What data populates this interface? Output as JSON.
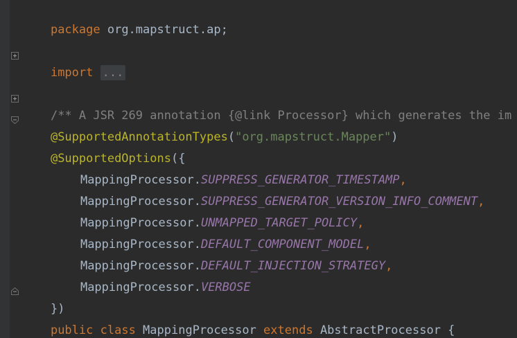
{
  "editor": {
    "lines": [
      {
        "parts": [
          "package",
          " org.mapstruct.ap;"
        ]
      },
      {
        "parts": [
          "import",
          " ",
          "..."
        ]
      },
      {
        "parts": [
          "/** A JSR 269 annotation {@link Processor} which generates the im"
        ]
      },
      {
        "parts": [
          "@SupportedAnnotationTypes",
          "(",
          "\"org.mapstruct.Mapper\"",
          ")"
        ]
      },
      {
        "parts": [
          "@SupportedOptions",
          "({"
        ]
      },
      {
        "parts": [
          "MappingProcessor.",
          "SUPPRESS_GENERATOR_TIMESTAMP",
          ","
        ]
      },
      {
        "parts": [
          "MappingProcessor.",
          "SUPPRESS_GENERATOR_VERSION_INFO_COMMENT",
          ","
        ]
      },
      {
        "parts": [
          "MappingProcessor.",
          "UNMAPPED_TARGET_POLICY",
          ","
        ]
      },
      {
        "parts": [
          "MappingProcessor.",
          "DEFAULT_COMPONENT_MODEL",
          ","
        ]
      },
      {
        "parts": [
          "MappingProcessor.",
          "DEFAULT_INJECTION_STRATEGY",
          ","
        ]
      },
      {
        "parts": [
          "MappingProcessor.",
          "VERBOSE"
        ]
      },
      {
        "parts": [
          "})"
        ]
      },
      {
        "parts": [
          "public",
          " ",
          "class",
          " MappingProcessor ",
          "extends",
          " AbstractProcessor {"
        ]
      }
    ],
    "fold_markers": [
      "fold-expand-icon",
      "fold-expand-icon",
      "fold-collapse-icon",
      "fold-end-icon"
    ]
  },
  "colors": {
    "background": "#2b2b2b",
    "keyword": "#cc7832",
    "plain": "#a9b7c6",
    "annotation": "#bbb529",
    "string": "#6a8759",
    "constant": "#9876aa",
    "comment": "#808080"
  }
}
